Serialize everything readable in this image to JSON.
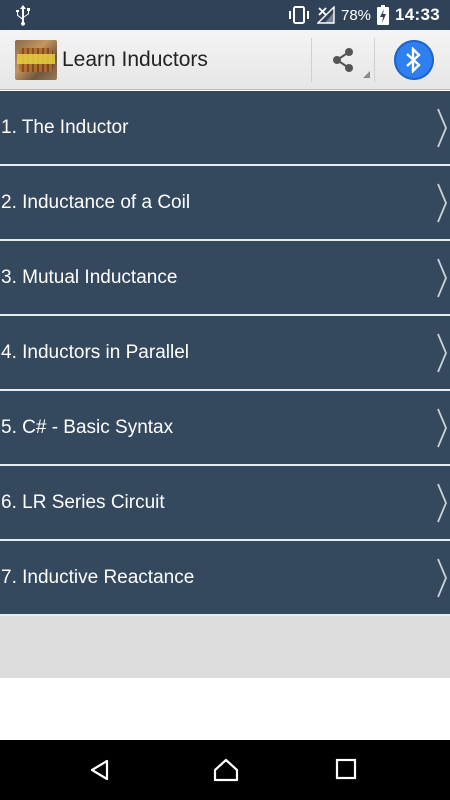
{
  "status_bar": {
    "battery_percent": "78%",
    "time": "14:33",
    "icons": [
      "usb-icon",
      "vibrate-icon",
      "signal-off-icon",
      "battery-charging-icon"
    ]
  },
  "action_bar": {
    "title": "Learn Inductors",
    "logo_icon": "app-logo-icon",
    "share_icon": "share-icon",
    "bluetooth_icon": "bluetooth-icon",
    "bluetooth_color": "#2e7ff0"
  },
  "list": {
    "item_color": "#34495e",
    "items": [
      {
        "label": "1. The Inductor"
      },
      {
        "label": "2. Inductance of a Coil"
      },
      {
        "label": "3. Mutual Inductance"
      },
      {
        "label": "4. Inductors in Parallel"
      },
      {
        "label": "5. C# - Basic Syntax"
      },
      {
        "label": "6. LR Series Circuit"
      },
      {
        "label": "7. Inductive Reactance"
      }
    ],
    "chevron_icon": "chevron-right-icon"
  },
  "nav_bar": {
    "icons": [
      "back-icon",
      "home-icon",
      "recents-icon"
    ]
  }
}
